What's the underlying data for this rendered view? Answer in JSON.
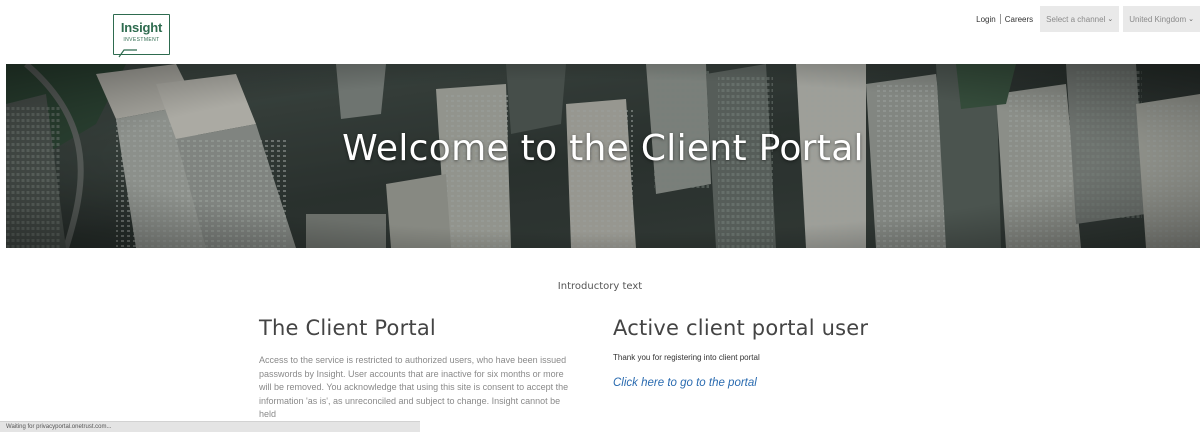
{
  "brand": {
    "logo_main": "Insight",
    "logo_sub": "INVESTMENT",
    "color": "#2e6b4f"
  },
  "nav": {
    "login": "Login",
    "careers": "Careers",
    "channel_select": "Select a channel",
    "region_select": "United Kingdom"
  },
  "hero": {
    "title": "Welcome to the Client Portal"
  },
  "main": {
    "intro": "Introductory text",
    "left": {
      "heading": "The Client Portal",
      "body": "Access to the service is restricted to authorized users, who have been issued passwords by Insight. User accounts that are inactive for six months or more will be removed. You acknowledge that using this site is consent to accept the information 'as is', as unreconciled and subject to change. Insight cannot be held"
    },
    "right": {
      "heading": "Active client portal user",
      "thanks": "Thank you for registering into client portal",
      "link": "Click here to go to the portal"
    }
  },
  "status_bar": {
    "text": "Waiting for privacyportal.onetrust.com..."
  },
  "colors": {
    "link": "#2a6bb0",
    "select_bg": "#e9e9e9"
  }
}
